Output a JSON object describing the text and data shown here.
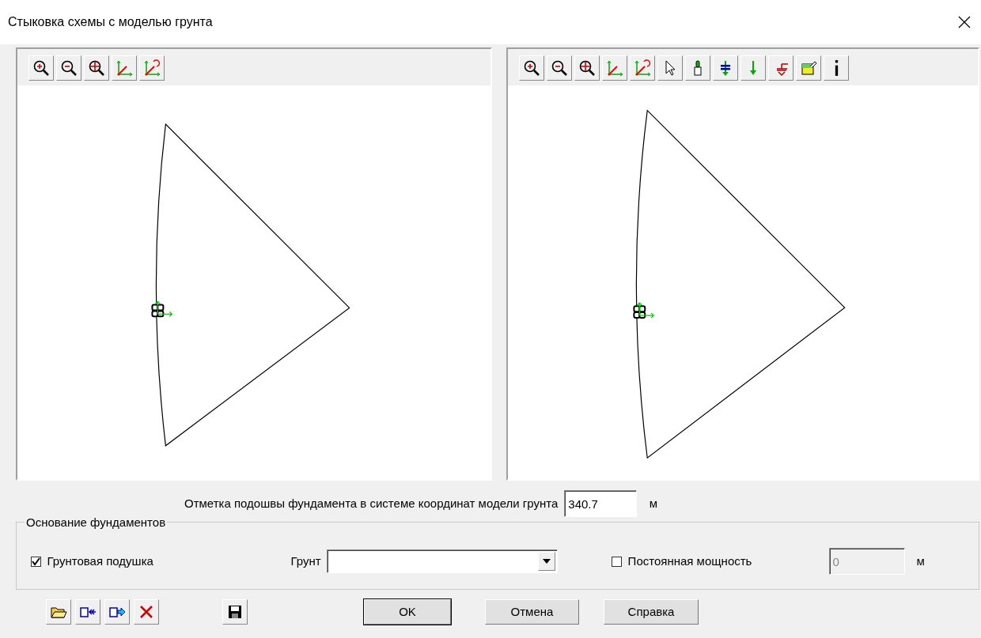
{
  "window": {
    "title": "Стыковка схемы с моделью грунта"
  },
  "elevation": {
    "label": "Отметка подошвы фундамента в системе координат модели грунта",
    "value": "340.7",
    "unit": "м"
  },
  "foundation_group": {
    "title": "Основание фундаментов",
    "soil_cushion": {
      "label": "Грунтовая подушка",
      "checked": true
    },
    "soil": {
      "label": "Грунт"
    },
    "constant_thickness": {
      "label": "Постоянная мощность",
      "checked": false
    },
    "thickness": {
      "value": "0",
      "disabled": true,
      "unit": "м"
    }
  },
  "buttons": [
    {
      "label": "OK",
      "default": true
    },
    {
      "label": "Отмена",
      "default": false
    },
    {
      "label": "Справка",
      "default": false
    }
  ]
}
